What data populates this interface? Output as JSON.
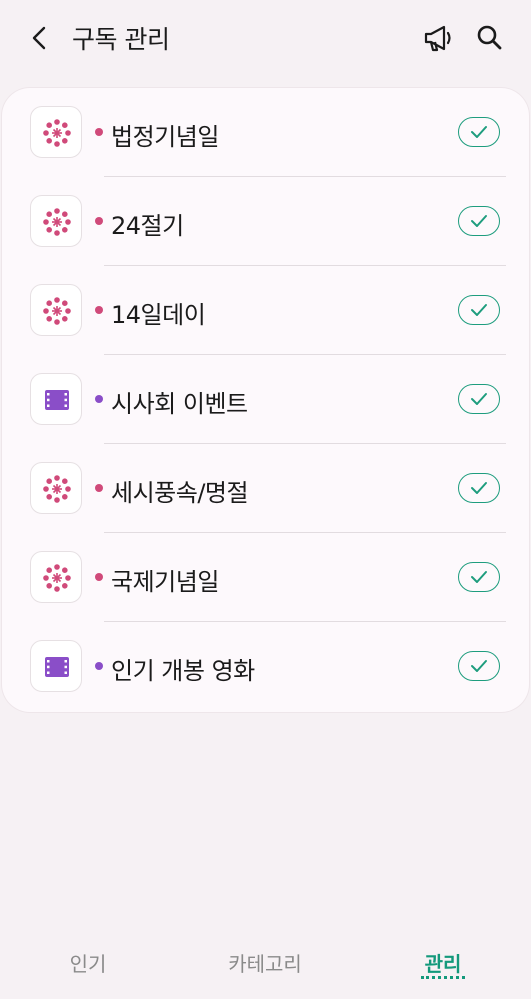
{
  "header": {
    "title": "구독 관리",
    "back_icon": "chevron-left-icon",
    "notice_icon": "megaphone-icon",
    "search_icon": "search-icon"
  },
  "subscriptions": [
    {
      "label": "법정기념일",
      "icon": "dots-circle-icon",
      "dot_color": "#d04a7a",
      "subscribed": true
    },
    {
      "label": "24절기",
      "icon": "dots-circle-icon",
      "dot_color": "#d04a7a",
      "subscribed": true
    },
    {
      "label": "14일데이",
      "icon": "dots-circle-icon",
      "dot_color": "#d04a7a",
      "subscribed": true
    },
    {
      "label": "시사회 이벤트",
      "icon": "film-icon",
      "dot_color": "#8a4ec8",
      "subscribed": true
    },
    {
      "label": "세시풍속/명절",
      "icon": "dots-circle-icon",
      "dot_color": "#d04a7a",
      "subscribed": true
    },
    {
      "label": "국제기념일",
      "icon": "dots-circle-icon",
      "dot_color": "#d04a7a",
      "subscribed": true
    },
    {
      "label": "인기 개봉 영화",
      "icon": "film-icon",
      "dot_color": "#8a4ec8",
      "subscribed": true
    }
  ],
  "bottom_nav": {
    "tabs": [
      {
        "label": "인기",
        "active": false
      },
      {
        "label": "카테고리",
        "active": false
      },
      {
        "label": "관리",
        "active": true
      }
    ]
  },
  "colors": {
    "accent": "#13997b",
    "pink": "#d04a7a",
    "purple": "#8a4ec8",
    "background": "#f6f1f4"
  }
}
